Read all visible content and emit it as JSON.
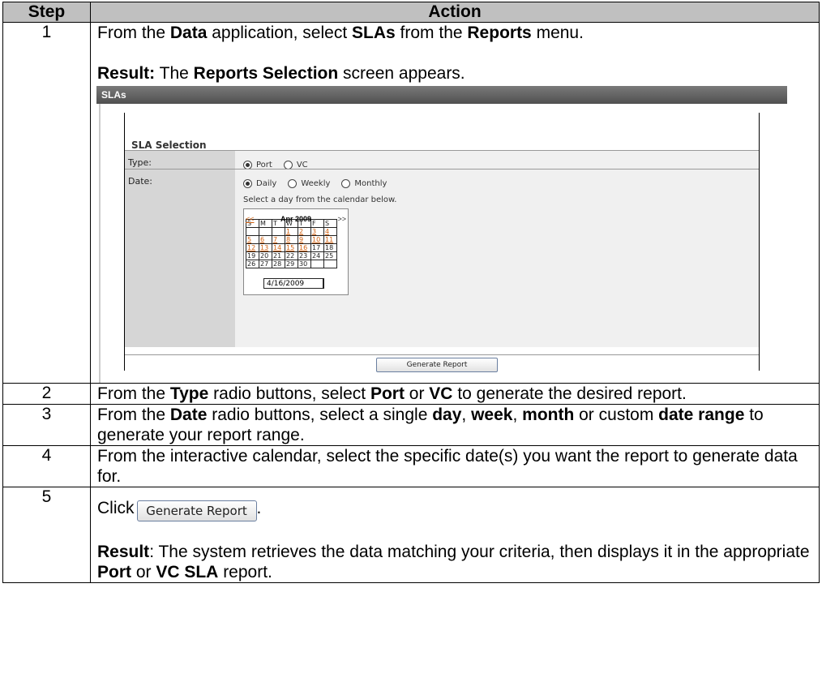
{
  "table": {
    "header_step": "Step",
    "header_action": "Action",
    "step1": {
      "num": "1",
      "p1": [
        "From the ",
        "Data",
        " application, select ",
        "SLAs",
        " from the ",
        "Reports",
        " menu."
      ],
      "p2": [
        "Result:",
        " The ",
        "Reports Selection",
        " screen appears."
      ]
    },
    "step2": {
      "num": "2",
      "text": [
        "From the ",
        "Type",
        " radio buttons, select ",
        "Port",
        " or ",
        "VC",
        " to generate the desired report."
      ]
    },
    "step3": {
      "num": "3",
      "text": [
        "From the ",
        "Date",
        " radio buttons, select a single ",
        "day",
        ", ",
        "week",
        ", ",
        "month",
        " or custom ",
        "date range",
        " to generate your report range."
      ]
    },
    "step4": {
      "num": "4",
      "text": "From the interactive calendar, select the specific date(s) you want the report to generate data for."
    },
    "step5": {
      "num": "5",
      "click": "Click",
      "period": ".",
      "result": [
        "Result",
        ":  The system retrieves the data matching your criteria, then displays it in the appropriate ",
        "Port",
        " or ",
        "VC SLA",
        " report."
      ]
    }
  },
  "sla_screen": {
    "title": "SLAs",
    "selection_title": "SLA Selection",
    "type_label": "Type:",
    "type_options": [
      "Port",
      "VC"
    ],
    "type_selected": "Port",
    "date_label": "Date:",
    "date_options": [
      "Daily",
      "Weekly",
      "Monthly"
    ],
    "date_selected": "Daily",
    "hint": "Select a day from the calendar below.",
    "calendar": {
      "prev": "<<",
      "month": "Apr 2009",
      "next": ">>",
      "weekdays": [
        "S",
        "M",
        "T",
        "W",
        "T",
        "F",
        "S"
      ],
      "weeks": [
        [
          "",
          "",
          "",
          "1",
          "2",
          "3",
          "4"
        ],
        [
          "5",
          "6",
          "7",
          "8",
          "9",
          "10",
          "11"
        ],
        [
          "12",
          "13",
          "14",
          "15",
          "16",
          "17",
          "18"
        ],
        [
          "19",
          "20",
          "21",
          "22",
          "23",
          "24",
          "25"
        ],
        [
          "26",
          "27",
          "28",
          "29",
          "30",
          "",
          ""
        ]
      ],
      "date_value": "4/16/2009"
    },
    "button": "Generate Report"
  },
  "generate_button": "Generate Report",
  "colors": {
    "link": "#d06010",
    "header_bg": "#c0c0c0",
    "titlebar": "#5a5a5a"
  }
}
